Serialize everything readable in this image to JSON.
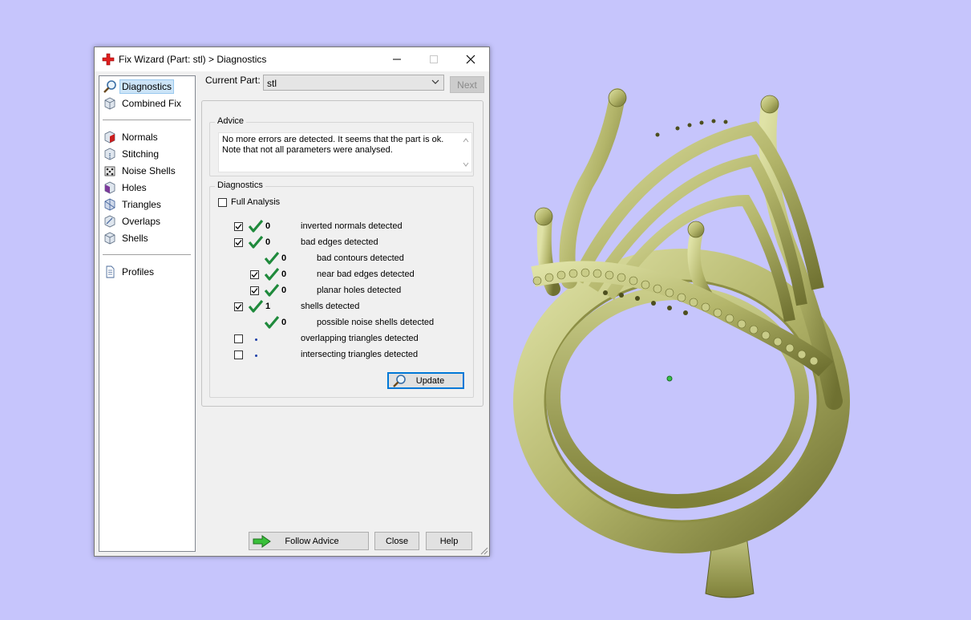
{
  "window": {
    "title": "Fix Wizard (Part: stl) > Diagnostics",
    "minimize_icon": "minimize-icon",
    "maximize_icon": "maximize-icon",
    "close_icon": "close-icon"
  },
  "sidebar": {
    "items": [
      {
        "label": "Diagnostics",
        "icon": "magnifier-icon",
        "selected": true
      },
      {
        "label": "Combined Fix",
        "icon": "cube-icon"
      },
      {
        "label": "Normals",
        "icon": "normals-cube-icon"
      },
      {
        "label": "Stitching",
        "icon": "stitching-cube-icon"
      },
      {
        "label": "Noise Shells",
        "icon": "noise-shells-icon"
      },
      {
        "label": "Holes",
        "icon": "holes-cube-icon"
      },
      {
        "label": "Triangles",
        "icon": "triangles-cube-icon"
      },
      {
        "label": "Overlaps",
        "icon": "overlaps-cube-icon"
      },
      {
        "label": "Shells",
        "icon": "shells-cube-icon"
      },
      {
        "label": "Profiles",
        "icon": "document-icon"
      }
    ]
  },
  "part": {
    "label": "Current Part:",
    "value": "stl",
    "next_label": "Next"
  },
  "advice": {
    "title": "Advice",
    "line1": "No more errors are detected. It seems that the part is ok.",
    "line2": "Note that not all parameters were analysed."
  },
  "diagnostics": {
    "title": "Diagnostics",
    "full_analysis_label": "Full Analysis",
    "full_analysis_checked": false,
    "rows": [
      {
        "label": "inverted normals detected",
        "count": "0",
        "checked": true,
        "status": "ok"
      },
      {
        "label": "bad edges detected",
        "count": "0",
        "checked": true,
        "status": "ok"
      },
      {
        "label": "bad contours detected",
        "count": "0",
        "status": "ok"
      },
      {
        "label": "near bad edges detected",
        "count": "0",
        "checked": true,
        "status": "ok"
      },
      {
        "label": "planar holes detected",
        "count": "0",
        "checked": true,
        "status": "ok"
      },
      {
        "label": "shells detected",
        "count": "1",
        "checked": true,
        "status": "ok"
      },
      {
        "label": "possible noise shells detected",
        "count": "0",
        "status": "ok"
      },
      {
        "label": "overlapping triangles detected",
        "checked": false,
        "status": "not-run"
      },
      {
        "label": "intersecting triangles detected",
        "checked": false,
        "status": "not-run"
      }
    ],
    "update_label": "Update"
  },
  "footer": {
    "follow_label": "Follow Advice",
    "close_label": "Close",
    "help_label": "Help"
  },
  "colors": {
    "background": "#c6c5fc",
    "model": "#b3b56a",
    "check_green": "#1f8a3c",
    "selection": "#cce4f7",
    "accent": "#0078d7"
  }
}
